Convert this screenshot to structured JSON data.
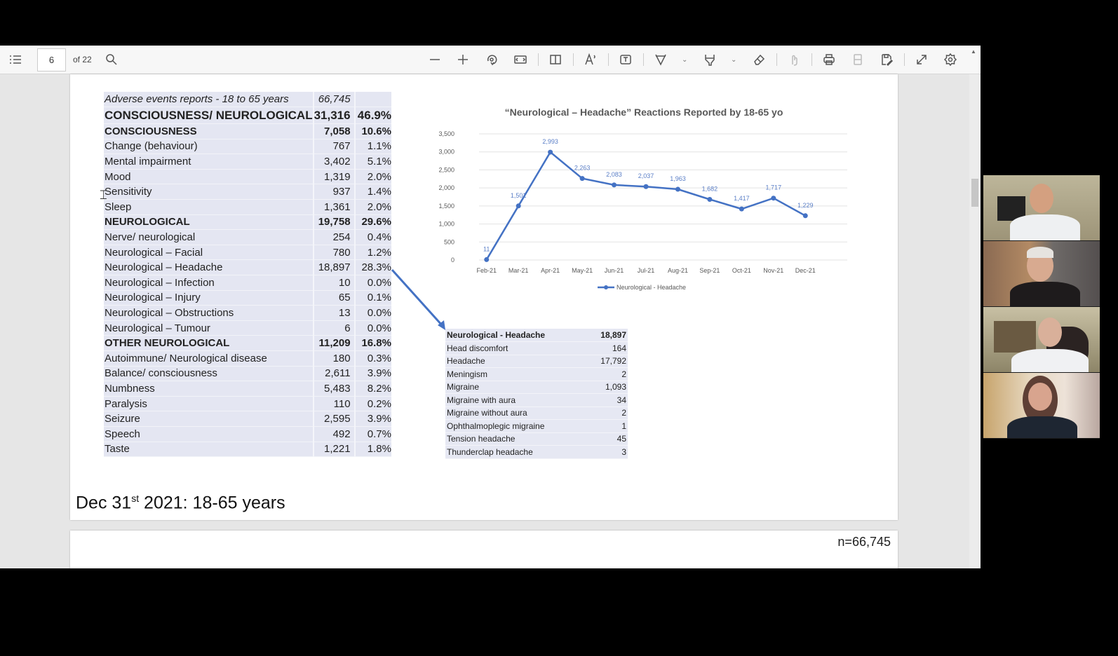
{
  "viewer": {
    "page_current": "6",
    "page_total_label": "of 22",
    "toolbar_icons": [
      "contents-icon",
      "search-icon",
      "zoom-out-icon",
      "zoom-in-icon",
      "rotate-icon",
      "fit-width-icon",
      "page-view-icon",
      "read-aloud-icon",
      "text-box-icon",
      "draw-icon",
      "highlight-icon",
      "erase-icon",
      "touch-icon",
      "print-icon",
      "save-icon",
      "save-as-icon",
      "fullscreen-icon",
      "settings-icon"
    ]
  },
  "main_table": {
    "header": {
      "label": "Adverse events reports - 18 to 65 years",
      "value": "66,745"
    },
    "rows": [
      {
        "label": "CONSCIOUSNESS/ NEUROLOGICAL",
        "value": "31,316",
        "pct": "46.9%",
        "style": "big"
      },
      {
        "label": "CONSCIOUSNESS",
        "value": "7,058",
        "pct": "10.6%",
        "style": "bold"
      },
      {
        "label": "Change (behaviour)",
        "value": "767",
        "pct": "1.1%",
        "style": ""
      },
      {
        "label": "Mental impairment",
        "value": "3,402",
        "pct": "5.1%",
        "style": ""
      },
      {
        "label": "Mood",
        "value": "1,319",
        "pct": "2.0%",
        "style": ""
      },
      {
        "label": "Sensitivity",
        "value": "937",
        "pct": "1.4%",
        "style": ""
      },
      {
        "label": "Sleep",
        "value": "1,361",
        "pct": "2.0%",
        "style": ""
      },
      {
        "label": "NEUROLOGICAL",
        "value": "19,758",
        "pct": "29.6%",
        "style": "bold"
      },
      {
        "label": "Nerve/ neurological",
        "value": "254",
        "pct": "0.4%",
        "style": ""
      },
      {
        "label": "Neurological – Facial",
        "value": "780",
        "pct": "1.2%",
        "style": ""
      },
      {
        "label": "Neurological – Headache",
        "value": "18,897",
        "pct": "28.3%",
        "style": ""
      },
      {
        "label": "Neurological – Infection",
        "value": "10",
        "pct": "0.0%",
        "style": ""
      },
      {
        "label": "Neurological – Injury",
        "value": "65",
        "pct": "0.1%",
        "style": ""
      },
      {
        "label": "Neurological – Obstructions",
        "value": "13",
        "pct": "0.0%",
        "style": ""
      },
      {
        "label": "Neurological – Tumour",
        "value": "6",
        "pct": "0.0%",
        "style": ""
      },
      {
        "label": "OTHER NEUROLOGICAL",
        "value": "11,209",
        "pct": "16.8%",
        "style": "bold"
      },
      {
        "label": "Autoimmune/ Neurological disease",
        "value": "180",
        "pct": "0.3%",
        "style": ""
      },
      {
        "label": "Balance/ consciousness",
        "value": "2,611",
        "pct": "3.9%",
        "style": ""
      },
      {
        "label": "Numbness",
        "value": "5,483",
        "pct": "8.2%",
        "style": ""
      },
      {
        "label": "Paralysis",
        "value": "110",
        "pct": "0.2%",
        "style": ""
      },
      {
        "label": "Seizure",
        "value": "2,595",
        "pct": "3.9%",
        "style": ""
      },
      {
        "label": "Speech",
        "value": "492",
        "pct": "0.7%",
        "style": ""
      },
      {
        "label": "Taste",
        "value": "1,221",
        "pct": "1.8%",
        "style": ""
      }
    ]
  },
  "sub_table": {
    "header": {
      "label": "Neurological - Headache",
      "value": "18,897"
    },
    "rows": [
      {
        "label": "Head discomfort",
        "value": "164"
      },
      {
        "label": "Headache",
        "value": "17,792"
      },
      {
        "label": "Meningism",
        "value": "2"
      },
      {
        "label": "Migraine",
        "value": "1,093"
      },
      {
        "label": "Migraine with aura",
        "value": "34"
      },
      {
        "label": "Migraine without aura",
        "value": "2"
      },
      {
        "label": "Ophthalmoplegic migraine",
        "value": "1"
      },
      {
        "label": "Tension headache",
        "value": "45"
      },
      {
        "label": "Thunderclap headache",
        "value": "3"
      }
    ]
  },
  "chart_data": {
    "type": "line",
    "title": "“Neurological – Headache” Reactions Reported by 18-65 yo",
    "xlabel": "",
    "ylabel": "",
    "categories": [
      "Feb-21",
      "Mar-21",
      "Apr-21",
      "May-21",
      "Jun-21",
      "Jul-21",
      "Aug-21",
      "Sep-21",
      "Oct-21",
      "Nov-21",
      "Dec-21"
    ],
    "series": [
      {
        "name": "Neurological - Headache",
        "values": [
          11,
          1501,
          2993,
          2263,
          2083,
          2037,
          1963,
          1682,
          1417,
          1717,
          1229
        ],
        "labels": [
          "11",
          "1,501",
          "2,993",
          "2,263",
          "2,083",
          "2,037",
          "1,963",
          "1,682",
          "1,417",
          "1,717",
          "1,229"
        ],
        "color": "#4472c4"
      }
    ],
    "ylim": [
      0,
      3500
    ],
    "yticks": [
      0,
      500,
      1000,
      1500,
      2000,
      2500,
      3000,
      3500
    ],
    "ytick_labels": [
      "0",
      "500",
      "1,000",
      "1,500",
      "2,000",
      "2,500",
      "3,000",
      "3,500"
    ],
    "grid": true,
    "legend": "bottom"
  },
  "slide_footer": {
    "title_pre": "Dec 31",
    "title_sup": "st",
    "title_post": " 2021: 18-65 years"
  },
  "next_page": {
    "n_label": "n=66,745"
  },
  "video_participants": 4
}
